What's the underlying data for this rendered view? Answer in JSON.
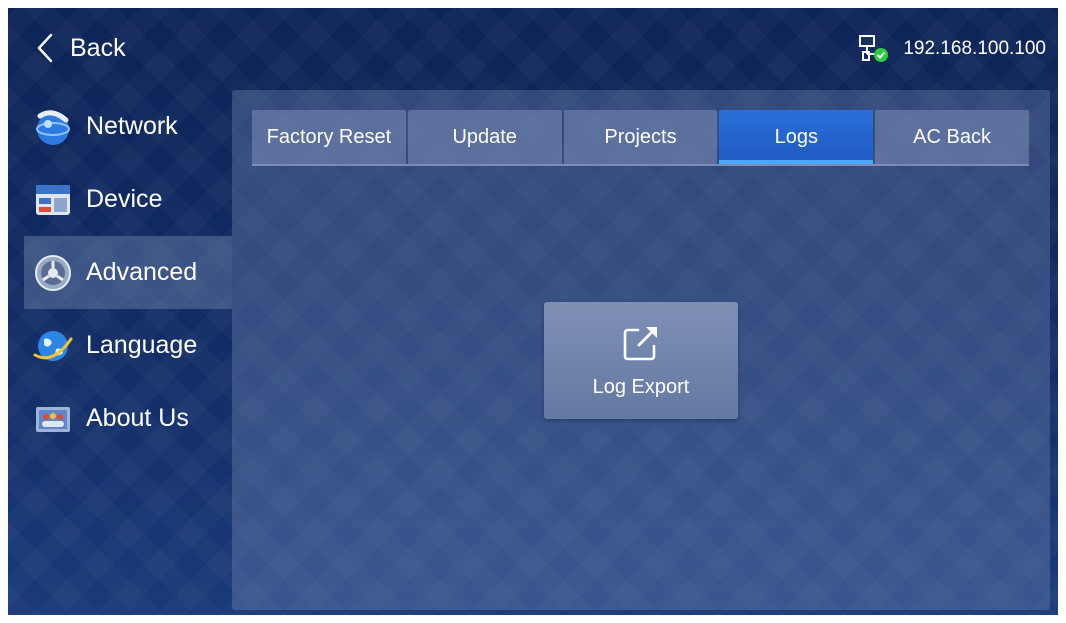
{
  "header": {
    "back_label": "Back",
    "ip_address": "192.168.100.100",
    "network_icon": "network-connected-icon",
    "connection_status_color": "#2ecc40"
  },
  "sidebar": {
    "items": [
      {
        "label": "Network",
        "icon": "network-globe-icon",
        "active": false
      },
      {
        "label": "Device",
        "icon": "device-icon",
        "active": false
      },
      {
        "label": "Advanced",
        "icon": "advanced-gear-icon",
        "active": true
      },
      {
        "label": "Language",
        "icon": "language-globe-icon",
        "active": false
      },
      {
        "label": "About Us",
        "icon": "about-us-icon",
        "active": false
      }
    ]
  },
  "main": {
    "tabs": [
      {
        "label": "Factory Reset",
        "active": false
      },
      {
        "label": "Update",
        "active": false
      },
      {
        "label": "Projects",
        "active": false
      },
      {
        "label": "Logs",
        "active": true
      },
      {
        "label": "AC Back",
        "active": false
      }
    ],
    "export_button": {
      "label": "Log Export",
      "icon": "export-icon"
    }
  },
  "colors": {
    "accent": "#1f5bc2",
    "tab_underline": "#4aa8ff"
  }
}
